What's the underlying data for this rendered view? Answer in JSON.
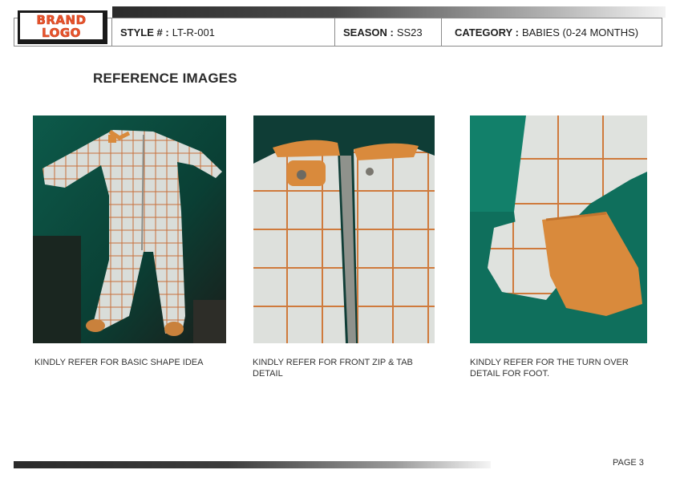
{
  "header": {
    "logo_line1": "BRAND",
    "logo_line2": "LOGO",
    "style_label": "STYLE # :",
    "style_value": "LT-R-001",
    "season_label": "SEASON :",
    "season_value": "SS23",
    "category_label": "CATEGORY :",
    "category_value": "BABIES (0-24 MONTHS)"
  },
  "section_title": "REFERENCE IMAGES",
  "images": [
    {
      "caption": "KINDLY REFER FOR BASIC SHAPE IDEA"
    },
    {
      "caption": "KINDLY REFER FOR FRONT ZIP & TAB DETAIL"
    },
    {
      "caption": "KINDLY REFER FOR THE TURN OVER DETAIL FOR FOOT."
    }
  ],
  "footer": {
    "page": "PAGE 3"
  },
  "colors": {
    "logo_text": "#e8542c",
    "fabric": "#dfe3e1",
    "grid_stripe": "#d5763a",
    "cuff_orange": "#d98a3c",
    "background_green": "#0f6f5c"
  }
}
